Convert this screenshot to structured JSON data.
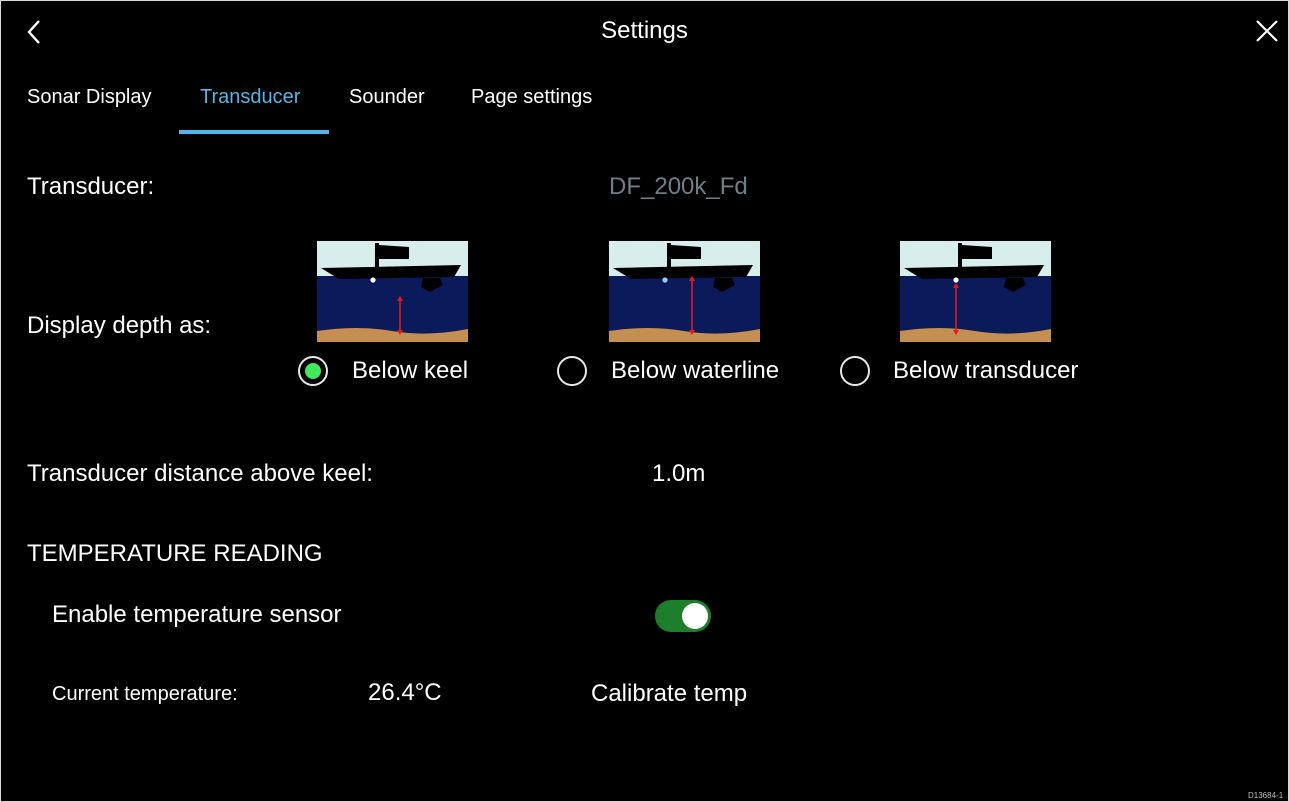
{
  "header": {
    "title": "Settings",
    "back_icon": "chevron-left-icon",
    "close_icon": "close-icon"
  },
  "tabs": [
    {
      "label": "Sonar Display",
      "active": false
    },
    {
      "label": "Transducer",
      "active": true
    },
    {
      "label": "Sounder",
      "active": false
    },
    {
      "label": "Page settings",
      "active": false
    }
  ],
  "transducer": {
    "label": "Transducer:",
    "value": "DF_200k_Fd"
  },
  "display_depth": {
    "label": "Display depth as:",
    "options": [
      {
        "label": "Below keel",
        "selected": true
      },
      {
        "label": "Below waterline",
        "selected": false
      },
      {
        "label": "Below transducer",
        "selected": false
      }
    ]
  },
  "keel_distance": {
    "label": "Transducer distance above keel:",
    "value": "1.0m"
  },
  "temperature": {
    "section_title": "TEMPERATURE READING",
    "enable_label": "Enable temperature sensor",
    "enabled": true,
    "current_label": "Current temperature:",
    "current_value": "26.4°C",
    "calibrate_label": "Calibrate temp"
  },
  "footer_id": "D13684-1",
  "colors": {
    "accent": "#55b4ea",
    "radio_selected": "#41e85a",
    "toggle_on": "#1e7f2a",
    "muted_value": "#6e7f86"
  }
}
